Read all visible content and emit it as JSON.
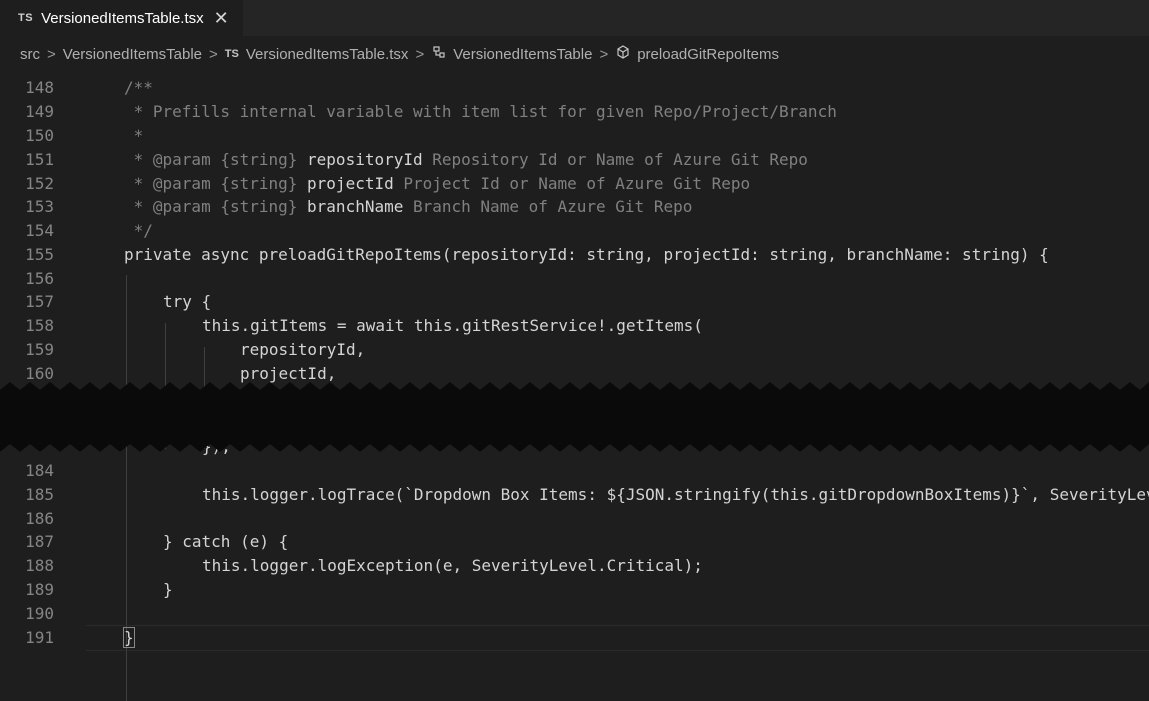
{
  "tab": {
    "lang_badge": "TS",
    "filename": "VersionedItemsTable.tsx",
    "close": "✕"
  },
  "breadcrumb": {
    "items": [
      "src",
      "VersionedItemsTable",
      "VersionedItemsTable.tsx",
      "VersionedItemsTable",
      "preloadGitRepoItems"
    ],
    "ts_badge": "TS",
    "separator": ">"
  },
  "lines": [
    {
      "n": "148"
    },
    {
      "n": "149"
    },
    {
      "n": "150"
    },
    {
      "n": "151"
    },
    {
      "n": "152"
    },
    {
      "n": "153"
    },
    {
      "n": "154"
    },
    {
      "n": "155"
    },
    {
      "n": "156"
    },
    {
      "n": "157"
    },
    {
      "n": "158"
    },
    {
      "n": "159"
    },
    {
      "n": "160"
    },
    {
      "n": "184"
    },
    {
      "n": "185"
    },
    {
      "n": "186"
    },
    {
      "n": "187"
    },
    {
      "n": "188"
    },
    {
      "n": "189"
    },
    {
      "n": "190"
    },
    {
      "n": "191"
    }
  ],
  "code": {
    "l148": "/**",
    "l149": " * Prefills internal variable with item list for given Repo/Project/Branch",
    "l150": " *",
    "l151a": " * @param {string} ",
    "l151b": "repositoryId",
    "l151c": " Repository Id or Name of Azure Git Repo",
    "l152a": " * @param {string} ",
    "l152b": "projectId",
    "l152c": " Project Id or Name of Azure Git Repo",
    "l153a": " * @param {string} ",
    "l153b": "branchName",
    "l153c": " Branch Name of Azure Git Repo",
    "l154": " */",
    "l155": "private async preloadGitRepoItems(repositoryId: string, projectId: string, branchName: string) {",
    "l157": "try {",
    "l158": "this.gitItems = await this.gitRestService!.getItems(",
    "l159": "repositoryId,",
    "l160": "projectId,",
    "l183": "});",
    "l185": "this.logger.logTrace(`Dropdown Box Items: ${JSON.stringify(this.gitDropdownBoxItems)}`, SeverityLev",
    "l187": "} catch (e) {",
    "l188": "this.logger.logException(e, SeverityLevel.Critical);",
    "l189": "}",
    "l191": "}"
  }
}
